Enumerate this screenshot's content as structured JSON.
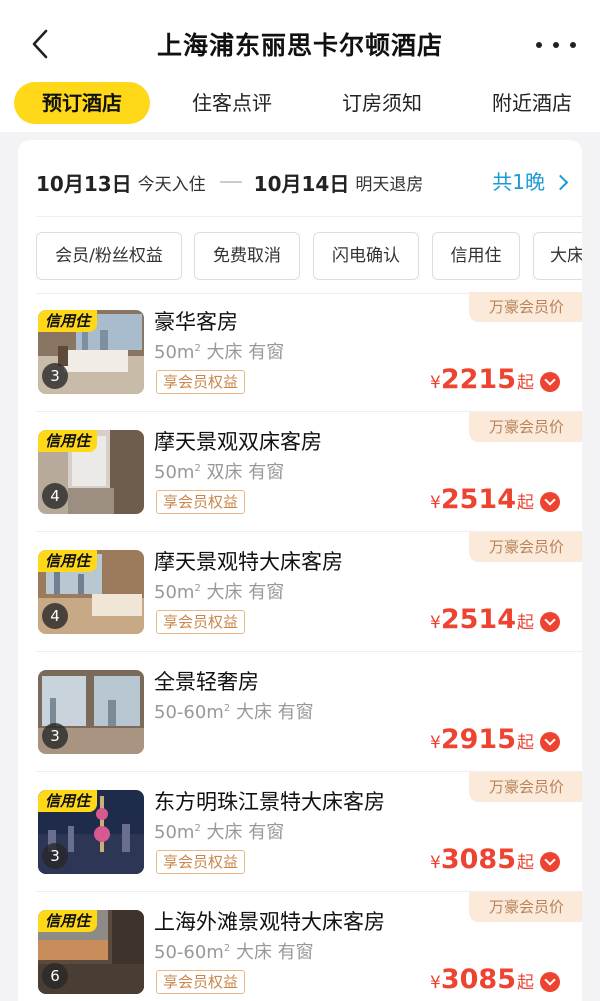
{
  "header": {
    "title": "上海浦东丽思卡尔顿酒店",
    "tabs": [
      "预订酒店",
      "住客点评",
      "订房须知",
      "附近酒店"
    ]
  },
  "booking": {
    "checkin_date": "10月13日",
    "checkin_label": "今天入住",
    "checkout_date": "10月14日",
    "checkout_label": "明天退房",
    "nights": "共1晚"
  },
  "filters": [
    "会员/粉丝权益",
    "免费取消",
    "闪电确认",
    "信用住",
    "大床"
  ],
  "labels": {
    "credit_tag": "信用住",
    "member_benefit": "享会员权益",
    "member_price": "万豪会员价",
    "currency": "¥",
    "from": "起"
  },
  "rooms": [
    {
      "name": "豪华客房",
      "size": "50m",
      "sup": "2",
      "spec": " 大床 有窗",
      "count": "3",
      "price": "2215"
    },
    {
      "name": "摩天景观双床客房",
      "size": "50m",
      "sup": "2",
      "spec": " 双床 有窗",
      "count": "4",
      "price": "2514"
    },
    {
      "name": "摩天景观特大床客房",
      "size": "50m",
      "sup": "2",
      "spec": " 大床 有窗",
      "count": "4",
      "price": "2514"
    },
    {
      "name": "全景轻奢房",
      "size": "50-60m",
      "sup": "2",
      "spec": " 大床 有窗",
      "count": "3",
      "price": "2915"
    },
    {
      "name": "东方明珠江景特大床客房",
      "size": "50m",
      "sup": "2",
      "spec": " 大床 有窗",
      "count": "3",
      "price": "3085"
    },
    {
      "name": "上海外滩景观特大床客房",
      "size": "50-60m",
      "sup": "2",
      "spec": " 大床 有窗",
      "count": "6",
      "price": "3085"
    }
  ],
  "colors": {
    "accent_yellow": "#ffd81a",
    "price_red": "#ee4330",
    "link_blue": "#1a9bd7"
  }
}
